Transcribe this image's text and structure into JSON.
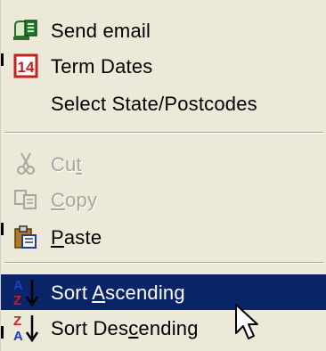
{
  "menu": {
    "items": [
      {
        "label": "Send email",
        "icon": "send-email-icon",
        "enabled": true
      },
      {
        "label": "Term Dates",
        "icon": "calendar-14-icon",
        "icon_text": "14",
        "enabled": true
      },
      {
        "label": "Select State/Postcodes",
        "icon": "",
        "enabled": true
      },
      {
        "label_pre": "Cu",
        "label_mn": "t",
        "label_post": "",
        "icon": "scissors-icon",
        "enabled": false
      },
      {
        "label_pre": "",
        "label_mn": "C",
        "label_post": "opy",
        "icon": "copy-icon",
        "enabled": false
      },
      {
        "label_pre": "",
        "label_mn": "P",
        "label_post": "aste",
        "icon": "paste-icon",
        "enabled": true
      },
      {
        "label_pre": "Sort ",
        "label_mn": "A",
        "label_post": "scending",
        "icon": "sort-ascending-icon",
        "enabled": true,
        "selected": true
      },
      {
        "label_pre": "Sort Des",
        "label_mn": "c",
        "label_post": "ending",
        "icon": "sort-descending-icon",
        "enabled": true
      }
    ]
  },
  "colors": {
    "menu_background": "#ece9d8",
    "highlight": "#0a246a",
    "disabled_text": "#a7a59c"
  }
}
